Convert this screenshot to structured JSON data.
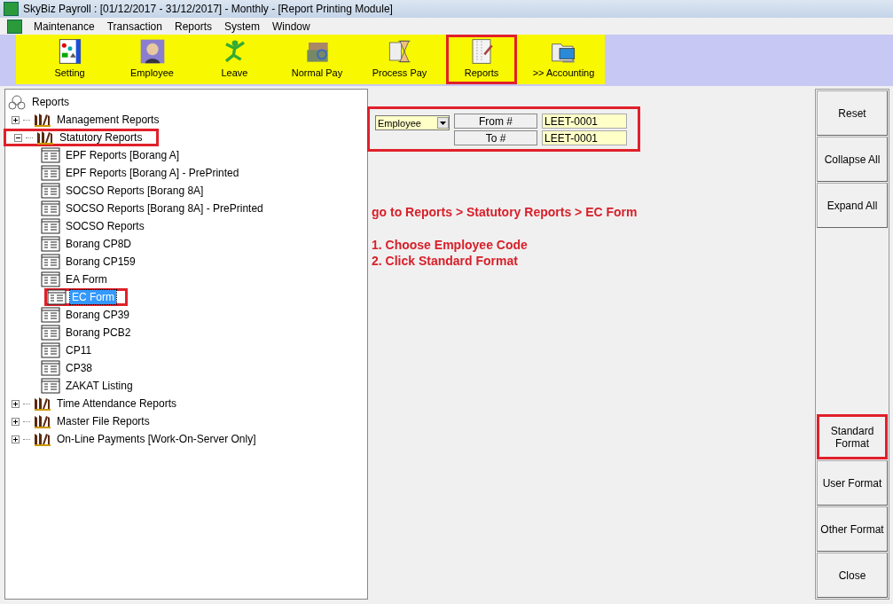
{
  "window": {
    "title": "SkyBiz Payroll : [01/12/2017 - 31/12/2017] - Monthly - [Report Printing Module]"
  },
  "menu": [
    "Maintenance",
    "Transaction",
    "Reports",
    "System",
    "Window"
  ],
  "toolbar": [
    {
      "label": "Setting",
      "kind": "setting",
      "highlighted": false
    },
    {
      "label": "Employee",
      "kind": "employee",
      "highlighted": false
    },
    {
      "label": "Leave",
      "kind": "leave",
      "highlighted": false
    },
    {
      "label": "Normal Pay",
      "kind": "pay",
      "highlighted": false
    },
    {
      "label": "Process Pay",
      "kind": "process",
      "highlighted": false
    },
    {
      "label": "Reports",
      "kind": "reports",
      "highlighted": true
    },
    {
      "label": ">> Accounting",
      "kind": "accounting",
      "highlighted": false
    }
  ],
  "tree": {
    "label": "Reports",
    "children": [
      {
        "label": "Management Reports",
        "expanded": false,
        "highlighted": false
      },
      {
        "label": "Statutory Reports",
        "expanded": true,
        "highlighted": true,
        "children": [
          {
            "label": "EPF Reports [Borang A]",
            "selected": false,
            "highlighted": false
          },
          {
            "label": "EPF Reports [Borang A] - PrePrinted",
            "selected": false,
            "highlighted": false
          },
          {
            "label": "SOCSO Reports [Borang 8A]",
            "selected": false,
            "highlighted": false
          },
          {
            "label": "SOCSO Reports [Borang 8A] - PrePrinted",
            "selected": false,
            "highlighted": false
          },
          {
            "label": "SOCSO Reports",
            "selected": false,
            "highlighted": false
          },
          {
            "label": "Borang CP8D",
            "selected": false,
            "highlighted": false
          },
          {
            "label": "Borang CP159",
            "selected": false,
            "highlighted": false
          },
          {
            "label": "EA Form",
            "selected": false,
            "highlighted": false
          },
          {
            "label": "EC Form",
            "selected": true,
            "highlighted": true
          },
          {
            "label": "Borang CP39",
            "selected": false,
            "highlighted": false
          },
          {
            "label": "Borang PCB2",
            "selected": false,
            "highlighted": false
          },
          {
            "label": "CP11",
            "selected": false,
            "highlighted": false
          },
          {
            "label": "CP38",
            "selected": false,
            "highlighted": false
          },
          {
            "label": "ZAKAT Listing",
            "selected": false,
            "highlighted": false
          }
        ]
      },
      {
        "label": "Time Attendance Reports",
        "expanded": false,
        "highlighted": false
      },
      {
        "label": "Master File Reports",
        "expanded": false,
        "highlighted": false
      },
      {
        "label": "On-Line Payments [Work-On-Server Only]",
        "expanded": false,
        "highlighted": false
      }
    ]
  },
  "filter": {
    "highlighted": true,
    "field_type": "Employee",
    "from_button": "From #",
    "from_value": "LEET-0001",
    "to_button": "To #",
    "to_value": "LEET-0001"
  },
  "instructions": [
    "go to Reports > Statutory Reports > EC Form",
    "1. Choose Employee Code",
    "2. Click Standard Format"
  ],
  "buttons_top": [
    {
      "label": "Reset",
      "highlighted": false
    },
    {
      "label": "Collapse All",
      "highlighted": false
    },
    {
      "label": "Expand All",
      "highlighted": false
    }
  ],
  "buttons_bottom": [
    {
      "label": "Standard Format",
      "highlighted": true
    },
    {
      "label": "User Format",
      "highlighted": false
    },
    {
      "label": "Other Format",
      "highlighted": false
    },
    {
      "label": "Close",
      "highlighted": false
    }
  ]
}
